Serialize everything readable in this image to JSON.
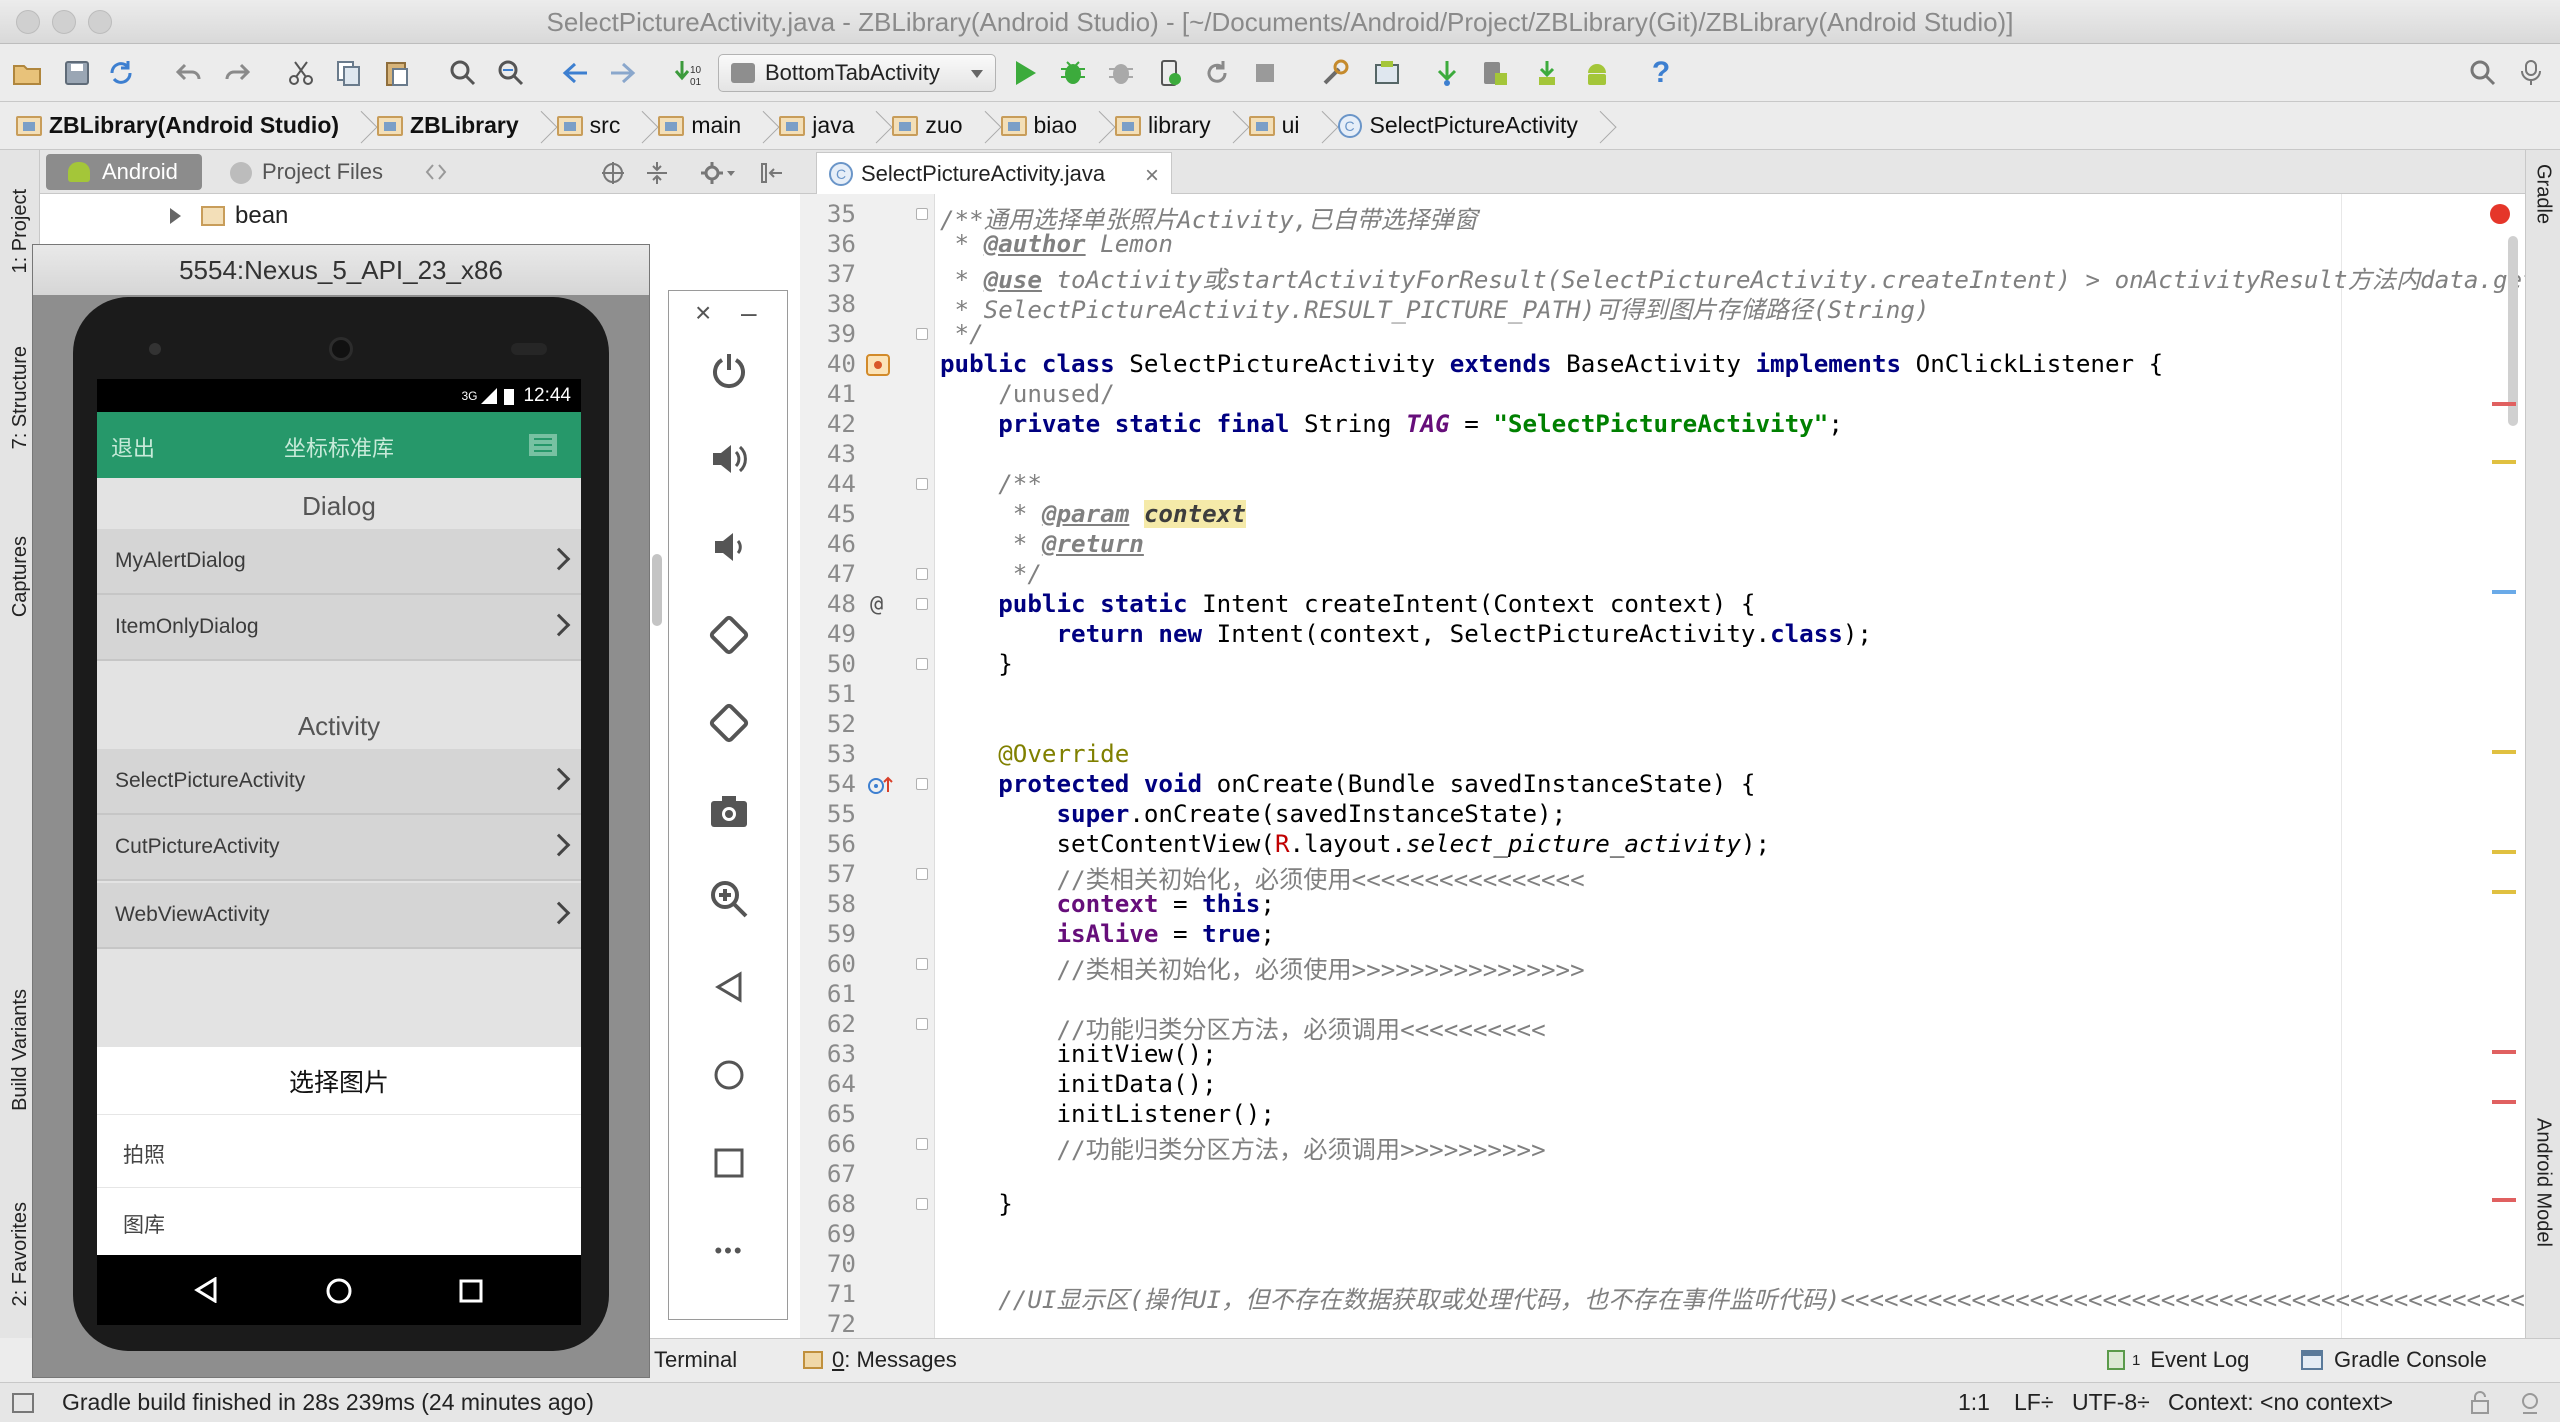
{
  "window": {
    "title": "SelectPictureActivity.java - ZBLibrary(Android Studio) - [~/Documents/Android/Project/ZBLibrary(Git)/ZBLibrary(Android Studio)]"
  },
  "toolbar": {
    "run_config": "BottomTabActivity",
    "help_icon_label": "?"
  },
  "breadcrumb": [
    "ZBLibrary(Android Studio)",
    "ZBLibrary",
    "src",
    "main",
    "java",
    "zuo",
    "biao",
    "library",
    "ui",
    "SelectPictureActivity"
  ],
  "left_tool_tabs": {
    "project": "1: Project",
    "structure": "7: Structure",
    "captures": "Captures",
    "build_variants": "Build Variants",
    "favorites": "2: Favorites"
  },
  "right_tool_tabs": {
    "gradle": "Gradle",
    "android_model": "Android Model"
  },
  "project_panel": {
    "tab_android": "Android",
    "tab_project_files": "Project Files",
    "tree_item": "bean"
  },
  "editor": {
    "tab_title": "SelectPictureActivity.java",
    "tab_close": "×"
  },
  "emulator": {
    "title": "5554:Nexus_5_API_23_x86",
    "status_time": "12:44",
    "status_net": "3G",
    "app_back": "退出",
    "app_title": "坐标标准库",
    "section_dialog": "Dialog",
    "section_activity": "Activity",
    "items": [
      "MyAlertDialog",
      "ItemOnlyDialog",
      "SelectPictureActivity",
      "CutPictureActivity",
      "WebViewActivity"
    ],
    "dialog_title": "选择图片",
    "dialog_options": [
      "拍照",
      "图库"
    ],
    "controls": {
      "close": "×",
      "minimize": "–",
      "more": "•••"
    }
  },
  "bottom_tabs": {
    "terminal": "Terminal",
    "messages_num": "0",
    "messages": ": Messages",
    "event_log_num": "1",
    "event_log": "Event Log",
    "gradle_console": "Gradle Console"
  },
  "status_bar": {
    "message": "Gradle build finished in 28s 239ms (24 minutes ago)",
    "position": "1:1",
    "line_sep": "LF",
    "encoding": "UTF-8",
    "context": "Context: <no context>"
  },
  "colors": {
    "app_green": "#26986a",
    "keyword": "#000080",
    "string": "#008000",
    "comment": "#808080",
    "line_number": "#8a8a8a"
  }
}
